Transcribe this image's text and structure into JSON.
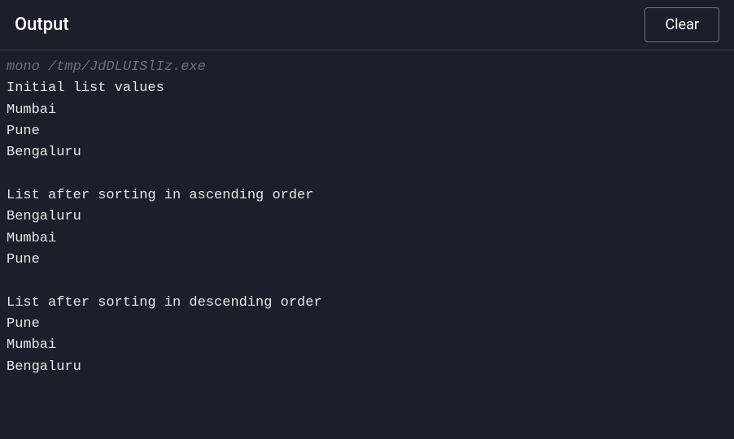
{
  "header": {
    "title": "Output",
    "clear_label": "Clear"
  },
  "console": {
    "command": "mono /tmp/JdDLUISlIz.exe",
    "lines": [
      "Initial list values",
      "Mumbai",
      "Pune",
      "Bengaluru",
      "",
      "List after sorting in ascending order",
      "Bengaluru",
      "Mumbai",
      "Pune",
      "",
      "List after sorting in descending order",
      "Pune",
      "Mumbai",
      "Bengaluru"
    ]
  }
}
